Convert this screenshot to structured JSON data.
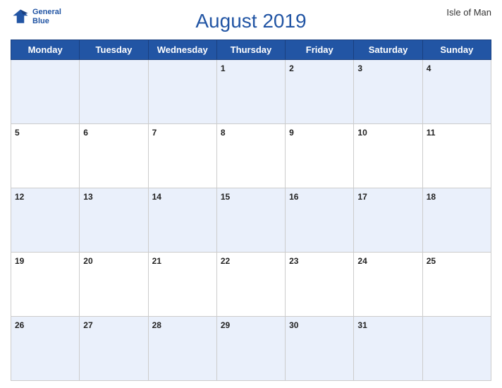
{
  "header": {
    "title": "August 2019",
    "region": "Isle of Man",
    "logo_line1": "General",
    "logo_line2": "Blue"
  },
  "weekdays": [
    "Monday",
    "Tuesday",
    "Wednesday",
    "Thursday",
    "Friday",
    "Saturday",
    "Sunday"
  ],
  "weeks": [
    [
      null,
      null,
      null,
      1,
      2,
      3,
      4
    ],
    [
      5,
      6,
      7,
      8,
      9,
      10,
      11
    ],
    [
      12,
      13,
      14,
      15,
      16,
      17,
      18
    ],
    [
      19,
      20,
      21,
      22,
      23,
      24,
      25
    ],
    [
      26,
      27,
      28,
      29,
      30,
      31,
      null
    ]
  ]
}
